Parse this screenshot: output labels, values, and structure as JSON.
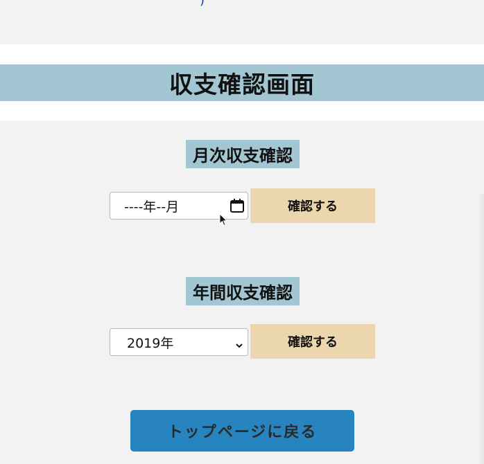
{
  "top_cut_glyph": ")",
  "page_title": "収支確認画面",
  "monthly": {
    "heading": "月次収支確認",
    "month_input_value": "----年--月",
    "confirm_label": "確認する"
  },
  "yearly": {
    "heading": "年間収支確認",
    "year_select_value": "2019年",
    "confirm_label": "確認する"
  },
  "back_button_label": "トップページに戻る",
  "colors": {
    "title_bar": "#a2c6d2",
    "confirm_button": "#ebd6ad",
    "back_button": "#2784be",
    "page_background": "#f2f2f2"
  },
  "icons": {
    "month_picker": "calendar-icon",
    "year_select": "chevron-down-icon",
    "pointer": "cursor-pointer-icon"
  }
}
